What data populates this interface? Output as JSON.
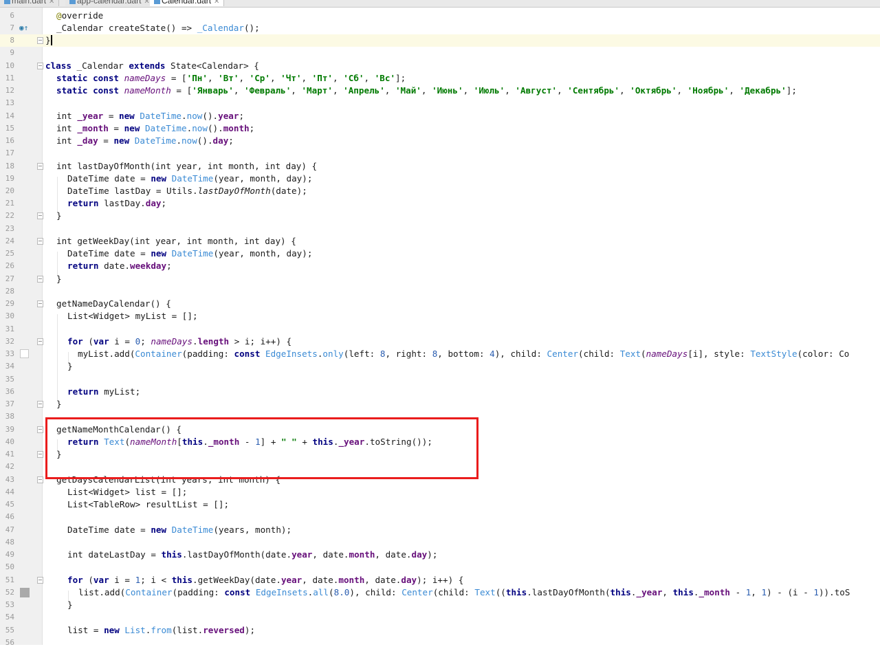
{
  "tabs": [
    {
      "label": "main.dart",
      "active": false
    },
    {
      "label": "app-calendar.dart",
      "active": false
    },
    {
      "label": "Calendar.dart",
      "active": true
    }
  ],
  "line_numbers": [
    "6",
    "7",
    "8",
    "9",
    "10",
    "11",
    "12",
    "13",
    "14",
    "15",
    "16",
    "17",
    "18",
    "19",
    "20",
    "21",
    "22",
    "23",
    "24",
    "25",
    "26",
    "27",
    "28",
    "29",
    "30",
    "31",
    "32",
    "33",
    "34",
    "35",
    "36",
    "37",
    "38",
    "39",
    "40",
    "41",
    "42",
    "43",
    "44",
    "45",
    "46",
    "47",
    "48",
    "49",
    "50",
    "51",
    "52",
    "53",
    "54",
    "55",
    "56"
  ],
  "code": {
    "l6_ann": "@",
    "l6_rest": "override",
    "l7_a": "_Calendar createState() => ",
    "l7_b": "_Calendar",
    "l7_c": "();",
    "l8": "}",
    "l10_kw1": "class",
    "l10_a": " _Calendar ",
    "l10_kw2": "extends",
    "l10_b": " State<Calendar> {",
    "l11_kw": "static const",
    "l11_fld": "nameDays",
    "l11_eq": " = [",
    "l11_days": [
      "'Пн'",
      "'Вт'",
      "'Ср'",
      "'Чт'",
      "'Пт'",
      "'Сб'",
      "'Вс'"
    ],
    "l11_end": "];",
    "l12_kw": "static const",
    "l12_fld": "nameMonth",
    "l12_eq": " = [",
    "l12_months": [
      "'Январь'",
      "'Февраль'",
      "'Март'",
      "'Апрель'",
      "'Май'",
      "'Июнь'",
      "'Июль'",
      "'Август'",
      "'Сентябрь'",
      "'Октябрь'",
      "'Ноябрь'",
      "'Декабрь'"
    ],
    "l12_end": "];",
    "l14": [
      "int ",
      "_year",
      " = ",
      "new",
      " ",
      "DateTime",
      ".",
      "now",
      "().",
      "year",
      ";"
    ],
    "l15": [
      "int ",
      "_month",
      " = ",
      "new",
      " ",
      "DateTime",
      ".",
      "now",
      "().",
      "month",
      ";"
    ],
    "l16": [
      "int ",
      "_day",
      " = ",
      "new",
      " ",
      "DateTime",
      ".",
      "now",
      "().",
      "day",
      ";"
    ],
    "l18": "int lastDayOfMonth(int year, int month, int day) {",
    "l19": [
      "DateTime date = ",
      "new",
      " ",
      "DateTime",
      "(year, month, day);"
    ],
    "l20": [
      "DateTime lastDay = Utils.",
      "lastDayOfMonth",
      "(date);"
    ],
    "l21": [
      "return",
      " lastDay.",
      "day",
      ";"
    ],
    "l22": "}",
    "l24": "int getWeekDay(int year, int month, int day) {",
    "l25": [
      "DateTime date = ",
      "new",
      " ",
      "DateTime",
      "(year, month, day);"
    ],
    "l26": [
      "return",
      " date.",
      "weekday",
      ";"
    ],
    "l27": "}",
    "l29": "getNameDayCalendar() {",
    "l30": "List<Widget> myList = [];",
    "l32": [
      "for",
      " (",
      "var",
      " i = ",
      "0",
      "; ",
      "nameDays",
      ".",
      "length",
      " > i; i++) {"
    ],
    "l33": [
      "myList.add(",
      "Container",
      "(padding: ",
      "const",
      " ",
      "EdgeInsets",
      ".",
      "only",
      "(left: ",
      "8",
      ", right: ",
      "8",
      ", bottom: ",
      "4",
      "), child: ",
      "Center",
      "(child: ",
      "Text",
      "(",
      "nameDays",
      "[i], style: ",
      "TextStyle",
      "(color: Co"
    ],
    "l34": "}",
    "l36": [
      "return",
      " myList;"
    ],
    "l37": "}",
    "l39": "getNameMonthCalendar() {",
    "l40": [
      "return",
      " ",
      "Text",
      "(",
      "nameMonth",
      "[",
      "this",
      ".",
      "_month",
      " - ",
      "1",
      "] + ",
      "\" \"",
      " + ",
      "this",
      ".",
      "_year",
      ".toString());"
    ],
    "l41": "}",
    "l43": "getDaysCalendarList(int years, int month) {",
    "l44": "List<Widget> list = [];",
    "l45": "List<TableRow> resultList = [];",
    "l47": [
      "DateTime date = ",
      "new",
      " ",
      "DateTime",
      "(years, month);"
    ],
    "l49": [
      "int dateLastDay = ",
      "this",
      ".lastDayOfMonth(date.",
      "year",
      ", date.",
      "month",
      ", date.",
      "day",
      ");"
    ],
    "l51": [
      "for",
      " (",
      "var",
      " i = ",
      "1",
      "; i < ",
      "this",
      ".getWeekDay(date.",
      "year",
      ", date.",
      "month",
      ", date.",
      "day",
      "); i++) {"
    ],
    "l52": [
      "list.add(",
      "Container",
      "(padding: ",
      "const",
      " ",
      "EdgeInsets",
      ".",
      "all",
      "(",
      "8.0",
      "), child: ",
      "Center",
      "(child: ",
      "Text",
      "((",
      "this",
      ".lastDayOfMonth(",
      "this",
      ".",
      "_year",
      ", ",
      "this",
      ".",
      "_month",
      " - ",
      "1",
      ", ",
      "1",
      ") - (i - ",
      "1",
      ")).toS"
    ],
    "l53": "}",
    "l55": [
      "list = ",
      "new",
      " ",
      "List",
      ".",
      "from",
      "(list.",
      "reversed",
      ");"
    ]
  },
  "colors": {
    "keyword": "#000080",
    "type": "#3a8ad4",
    "string": "#007a00",
    "field": "#660e7a",
    "callout": "#ea1c1c",
    "current_line": "#fcfae4"
  }
}
